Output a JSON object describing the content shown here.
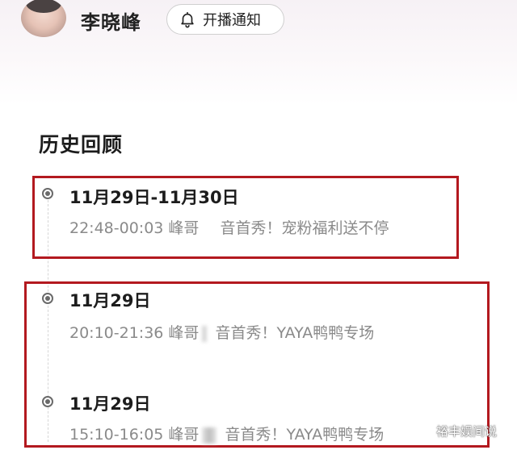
{
  "profile": {
    "name": "李晓峰",
    "notify_label": "开播通知"
  },
  "history": {
    "title": "历史回顾",
    "entries": [
      {
        "date": "11月29日-11月30日",
        "time": "22:48-00:03",
        "host": "峰哥",
        "show": "音首秀！宠粉福利送不停"
      },
      {
        "date": "11月29日",
        "time": "20:10-21:36",
        "host": "峰哥",
        "show": "音首秀！YAYA鸭鸭专场"
      },
      {
        "date": "11月29日",
        "time": "15:10-16:05",
        "host": "峰哥",
        "show": "音首秀！YAYA鸭鸭专场"
      }
    ]
  },
  "watermark": "裕丰娱间说",
  "colors": {
    "highlight_box": "#b3191f",
    "detail_text": "#8a8a8a"
  }
}
